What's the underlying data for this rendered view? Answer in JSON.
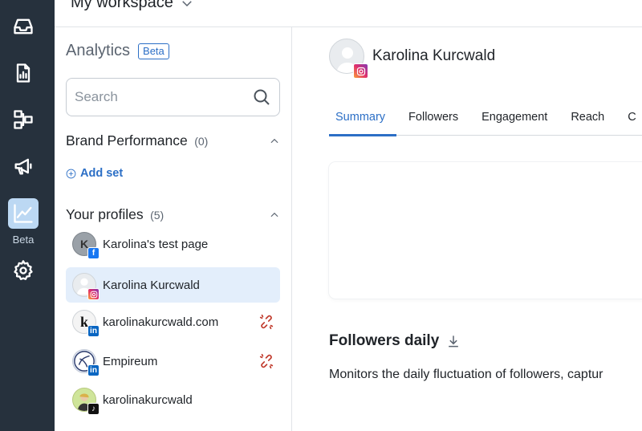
{
  "topbar": {
    "workspace_label": "My workspace"
  },
  "rail": {
    "items": [
      {
        "icon": "inbox-icon"
      },
      {
        "icon": "report-icon"
      },
      {
        "icon": "workflow-icon"
      },
      {
        "icon": "megaphone-icon"
      },
      {
        "icon": "analytics-icon",
        "badge": "Beta",
        "active": true
      },
      {
        "icon": "gear-icon"
      }
    ]
  },
  "sidebar": {
    "title": "Analytics",
    "beta_badge": "Beta",
    "search_placeholder": "Search",
    "brand_performance": {
      "label": "Brand Performance",
      "count": "(0)"
    },
    "add_set_label": "Add set",
    "profiles_section": {
      "label": "Your profiles",
      "count": "(5)"
    },
    "profiles": [
      {
        "name": "Karolina's test page",
        "avatar_text": "K",
        "network": "facebook",
        "selected": false,
        "broken_link": false
      },
      {
        "name": "Karolina Kurcwald",
        "avatar_text": "",
        "network": "instagram",
        "selected": true,
        "broken_link": false
      },
      {
        "name": "karolinakurcwald.com",
        "avatar_text": "k",
        "network": "linkedin",
        "selected": false,
        "broken_link": true
      },
      {
        "name": "Empireum",
        "avatar_text": "",
        "network": "linkedin",
        "selected": false,
        "broken_link": true
      },
      {
        "name": "karolinakurcwald",
        "avatar_text": "",
        "network": "tiktok",
        "selected": false,
        "broken_link": false
      }
    ]
  },
  "main": {
    "profile_name": "Karolina Kurcwald",
    "tabs": [
      {
        "label": "Summary",
        "active": true
      },
      {
        "label": "Followers"
      },
      {
        "label": "Engagement"
      },
      {
        "label": "Reach"
      },
      {
        "label": "C"
      }
    ],
    "followers_daily": {
      "title": "Followers daily",
      "description": "Monitors the daily fluctuation of followers, captur"
    }
  },
  "colors": {
    "rail_bg": "#26313d",
    "accent": "#2c6fc6",
    "selected_bg": "#e3eefb",
    "broken_link": "#c0392b"
  }
}
